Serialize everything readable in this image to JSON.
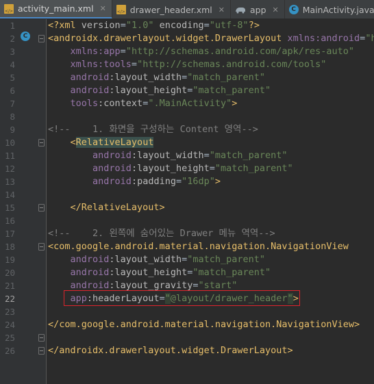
{
  "tabs": [
    {
      "label": "activity_main.xml",
      "icon": "xml-file-icon",
      "active": true
    },
    {
      "label": "drawer_header.xml",
      "icon": "xml-file-icon",
      "active": false
    },
    {
      "label": "app",
      "icon": "android-module-icon",
      "active": false
    },
    {
      "label": "MainActivity.java",
      "icon": "java-class-icon",
      "active": false
    }
  ],
  "line_numbers": [
    "1",
    "2",
    "3",
    "4",
    "5",
    "6",
    "7",
    "8",
    "9",
    "10",
    "11",
    "12",
    "13",
    "14",
    "15",
    "16",
    "17",
    "18",
    "19",
    "20",
    "21",
    "22",
    "23",
    "24",
    "25",
    "26"
  ],
  "current_line": "22",
  "gutter_class_badge": "C",
  "code": {
    "l1": {
      "a": "<?xml ",
      "b": "version",
      "c": "=",
      "d": "\"1.0\"",
      "e": " ",
      "f": "encoding",
      "g": "=",
      "h": "\"utf-8\"",
      "i": "?>"
    },
    "l2": {
      "tag": "<androidx.drawerlayout.widget.DrawerLayout ",
      "ns": "xmlns:android",
      "eq": "=",
      "val": "\"ht"
    },
    "l3": {
      "ns": "xmlns:app",
      "eq": "=",
      "val": "\"http://schemas.android.com/apk/res-auto\""
    },
    "l4": {
      "ns": "xmlns:tools",
      "eq": "=",
      "val": "\"http://schemas.android.com/tools\""
    },
    "l5": {
      "ns": "android",
      "attr": ":layout_width",
      "eq": "=",
      "val": "\"match_parent\""
    },
    "l6": {
      "ns": "android",
      "attr": ":layout_height",
      "eq": "=",
      "val": "\"match_parent\""
    },
    "l7": {
      "ns": "tools",
      "attr": ":context",
      "eq": "=",
      "val": "\".MainActivity\"",
      "end": ">"
    },
    "l9": {
      "text": "<!--    1. 화면을 구성하는 Content 영역-->"
    },
    "l10": {
      "open": "<",
      "tag": "RelativeLayout"
    },
    "l11": {
      "ns": "android",
      "attr": ":layout_width",
      "eq": "=",
      "val": "\"match_parent\""
    },
    "l12": {
      "ns": "android",
      "attr": ":layout_height",
      "eq": "=",
      "val": "\"match_parent\""
    },
    "l13": {
      "ns": "android",
      "attr": ":padding",
      "eq": "=",
      "val": "\"16dp\"",
      "end": ">"
    },
    "l15": {
      "tag": "</RelativeLayout>"
    },
    "l17": {
      "text": "<!--    2. 왼쪽에 숨어있는 Drawer 메뉴 역역-->"
    },
    "l18": {
      "tag": "<com.google.android.material.navigation.NavigationView"
    },
    "l19": {
      "ns": "android",
      "attr": ":layout_width",
      "eq": "=",
      "val": "\"match_parent\""
    },
    "l20": {
      "ns": "android",
      "attr": ":layout_height",
      "eq": "=",
      "val": "\"match_parent\""
    },
    "l21": {
      "ns": "android",
      "attr": ":layout_gravity",
      "eq": "=",
      "val": "\"start\""
    },
    "l22": {
      "ns": "app",
      "attr": ":headerLayout",
      "eq": "=",
      "q1": "\"",
      "val": "@layout/drawer_header",
      "q2": "\"",
      "end": ">"
    },
    "l24": {
      "tag": "</com.google.android.material.navigation.NavigationView>"
    },
    "l26": {
      "tag": "</androidx.drawerlayout.widget.DrawerLayout>"
    }
  },
  "colors": {
    "background": "#2b2b2b",
    "gutter": "#313335",
    "tag": "#e8bf6a",
    "namespace": "#9876aa",
    "attribute": "#bababa",
    "string": "#6a8759",
    "comment": "#808080",
    "highlight_box": "#e0242c",
    "active_tab_underline": "#4a88c7"
  }
}
